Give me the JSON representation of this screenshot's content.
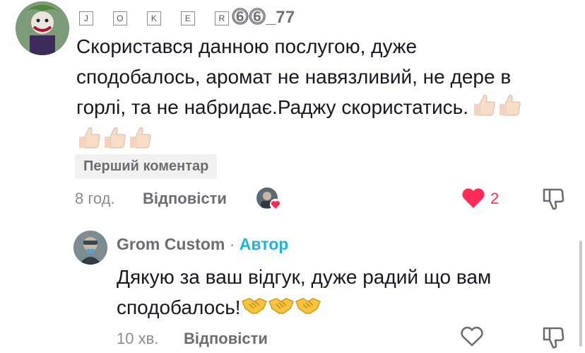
{
  "comment1": {
    "username_letters": [
      "J",
      "O",
      "K",
      "E",
      "R"
    ],
    "username_tail": "⓺⓺_77",
    "text_line1": "Скористався данною послугою, дуже",
    "text_line2": "сподобалось, аромат не навязливий, не дере в",
    "text_line3": "горлі, та не набридає.Раджу скористатись.",
    "emoji_name": "thumbs-up",
    "emoji_count": 5,
    "badge": "Перший коментар",
    "time": "8 год.",
    "reply_label": "Відповісти",
    "like_count": "2",
    "liked": true
  },
  "reply1": {
    "username": "Grom Custom",
    "separator": " · ",
    "author_label": "Автор",
    "text_line1": "Дякую за ваш відгук, дуже радий що вам",
    "text_line2": "сподобалось!",
    "emoji_name": "handshake",
    "emoji_count": 3,
    "time": "10 хв.",
    "reply_label": "Відповісти"
  },
  "colors": {
    "like_red": "#fe2c55",
    "author_blue": "#20b4d8",
    "meta_gray": "#8a8b91"
  }
}
